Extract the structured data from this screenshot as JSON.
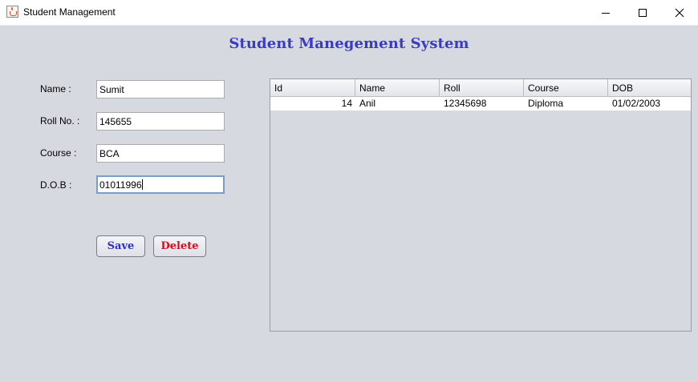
{
  "window": {
    "title": "Student Management"
  },
  "heading": "Student Manegement System",
  "form": {
    "name_label": "Name :",
    "name_value": "Sumit",
    "roll_label": "Roll No. :",
    "roll_value": "145655",
    "course_label": "Course :",
    "course_value": "BCA",
    "dob_label": "D.O.B :",
    "dob_value": "01011996"
  },
  "buttons": {
    "save": "Save",
    "delete": "Delete"
  },
  "table": {
    "columns": [
      "Id",
      "Name",
      "Roll",
      "Course",
      "DOB"
    ],
    "rows": [
      [
        "14",
        "Anil",
        "12345698",
        "Diploma",
        "01/02/2003"
      ]
    ]
  },
  "colors": {
    "heading": "#3a3ac8",
    "save": "#3030c0",
    "delete": "#d01020",
    "panel": "#d6d9e0"
  }
}
